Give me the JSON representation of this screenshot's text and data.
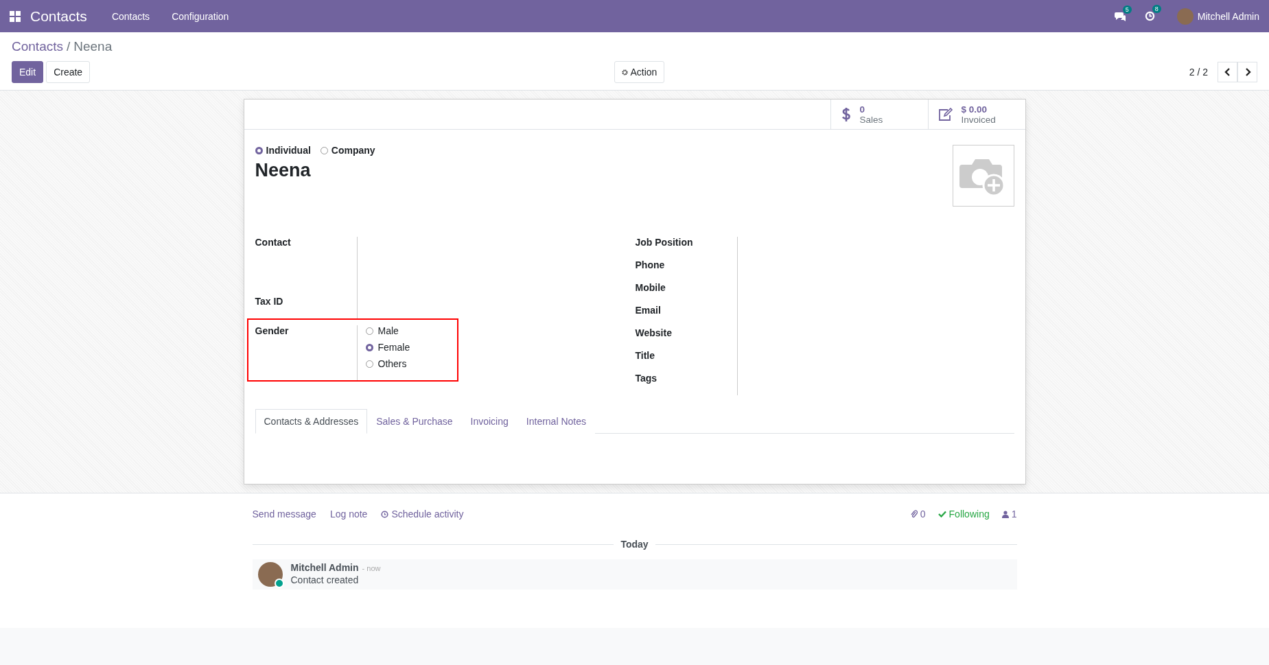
{
  "navbar": {
    "app_title": "Contacts",
    "menu": [
      "Contacts",
      "Configuration"
    ],
    "messages_count": "5",
    "activities_count": "8",
    "user": "Mitchell Admin"
  },
  "breadcrumb": [
    "Contacts",
    "Neena"
  ],
  "breadcrumb_separator": "/",
  "buttons": [
    {
      "label": "Edit",
      "kind": "primary"
    },
    {
      "label": "Create",
      "kind": "secondary"
    }
  ],
  "action": "Action",
  "pager": "2 / 2",
  "stat_buttons": [
    {
      "value": "0",
      "label": "Sales",
      "kind": "dollar"
    },
    {
      "value": "$ 0.00",
      "label": "Invoiced",
      "kind": "edit"
    }
  ],
  "company_type": [
    {
      "label": "Individual",
      "selected": true
    },
    {
      "label": "Company",
      "selected": false
    }
  ],
  "name": "Neena",
  "left_fields": [
    {
      "label": "Contact",
      "kind": "address"
    },
    {
      "label": "Tax ID",
      "kind": "line"
    }
  ],
  "gender": {
    "label": "Gender",
    "highlighted": true,
    "options": [
      {
        "label": "Male",
        "selected": false
      },
      {
        "label": "Female",
        "selected": true
      },
      {
        "label": "Others",
        "selected": false
      }
    ]
  },
  "right_fields": [
    "Job Position",
    "Phone",
    "Mobile",
    "Email",
    "Website",
    "Title",
    "Tags"
  ],
  "tabs": [
    {
      "label": "Contacts & Addresses",
      "selected": true
    },
    {
      "label": "Sales & Purchase",
      "selected": false
    },
    {
      "label": "Invoicing",
      "selected": false
    },
    {
      "label": "Internal Notes",
      "selected": false
    }
  ],
  "chatter": {
    "actions": [
      {
        "label": "Send message",
        "kind": "plain"
      },
      {
        "label": "Log note",
        "kind": "plain"
      },
      {
        "label": "Schedule activity",
        "kind": "clock"
      }
    ],
    "attachments": "0",
    "following": "Following",
    "followers": "1",
    "date": "Today",
    "message": {
      "author": "Mitchell Admin",
      "time": "- now",
      "body": "Contact created"
    }
  }
}
